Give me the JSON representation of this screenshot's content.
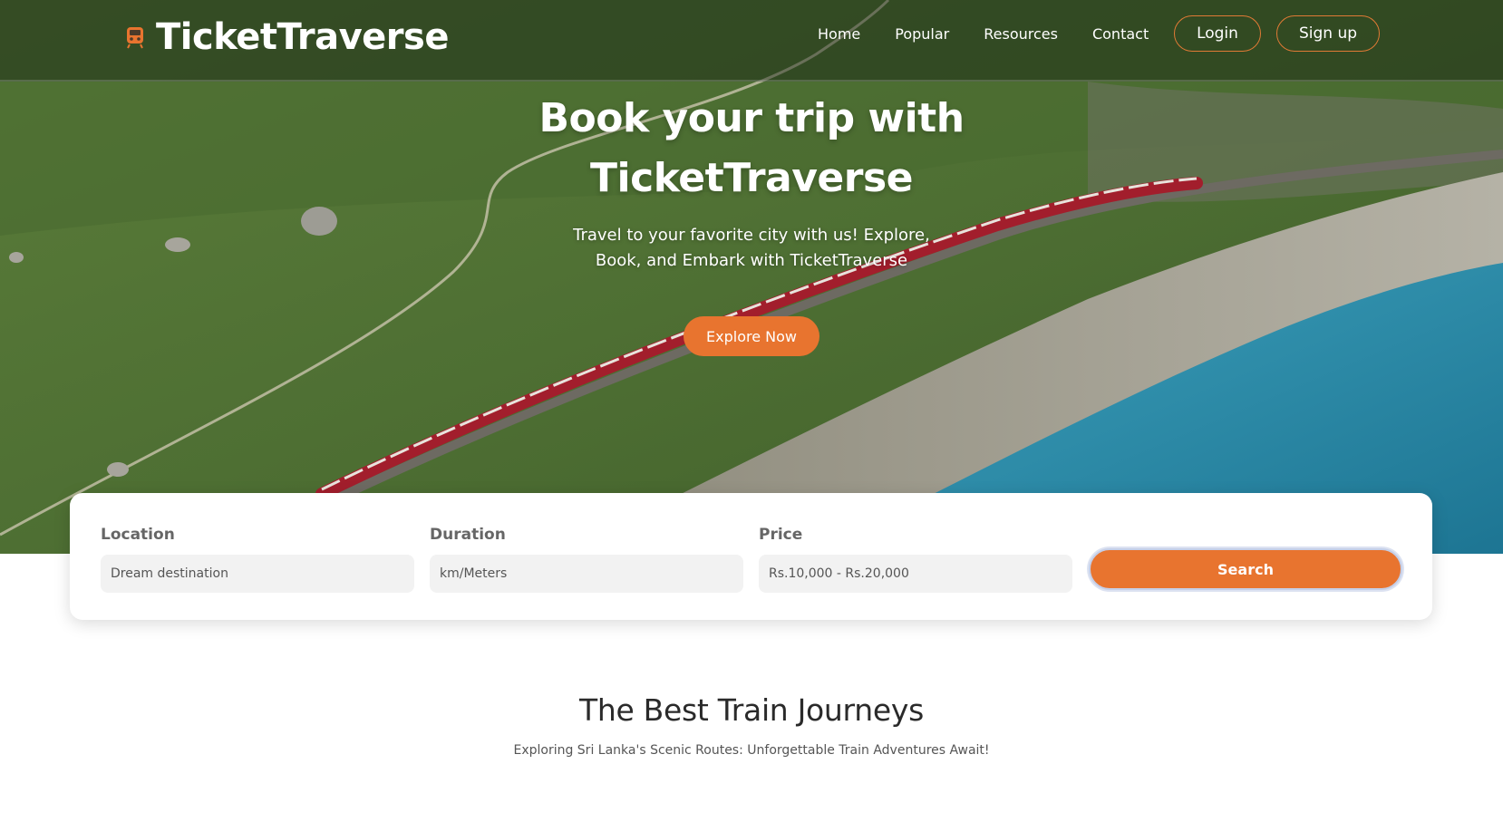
{
  "brand": {
    "name": "TicketTraverse",
    "icon": "train-icon",
    "accent": "#e8742f"
  },
  "nav": {
    "links": [
      "Home",
      "Popular",
      "Resources",
      "Contact"
    ],
    "login": "Login",
    "signup": "Sign up"
  },
  "hero": {
    "title_line1": "Book your trip with",
    "title_line2": "TicketTraverse",
    "subtitle": "Travel to your favorite city with us! Explore, Book, and Embark with TicketTraverse",
    "cta": "Explore Now"
  },
  "search": {
    "location": {
      "label": "Location",
      "placeholder": "Dream destination"
    },
    "duration": {
      "label": "Duration",
      "placeholder": "km/Meters"
    },
    "price": {
      "label": "Price",
      "placeholder": "Rs.10,000 - Rs.20,000"
    },
    "button": "Search"
  },
  "section": {
    "title": "The Best Train Journeys",
    "subtitle": "Exploring Sri Lanka's Scenic Routes: Unforgettable Train Adventures Await!"
  }
}
